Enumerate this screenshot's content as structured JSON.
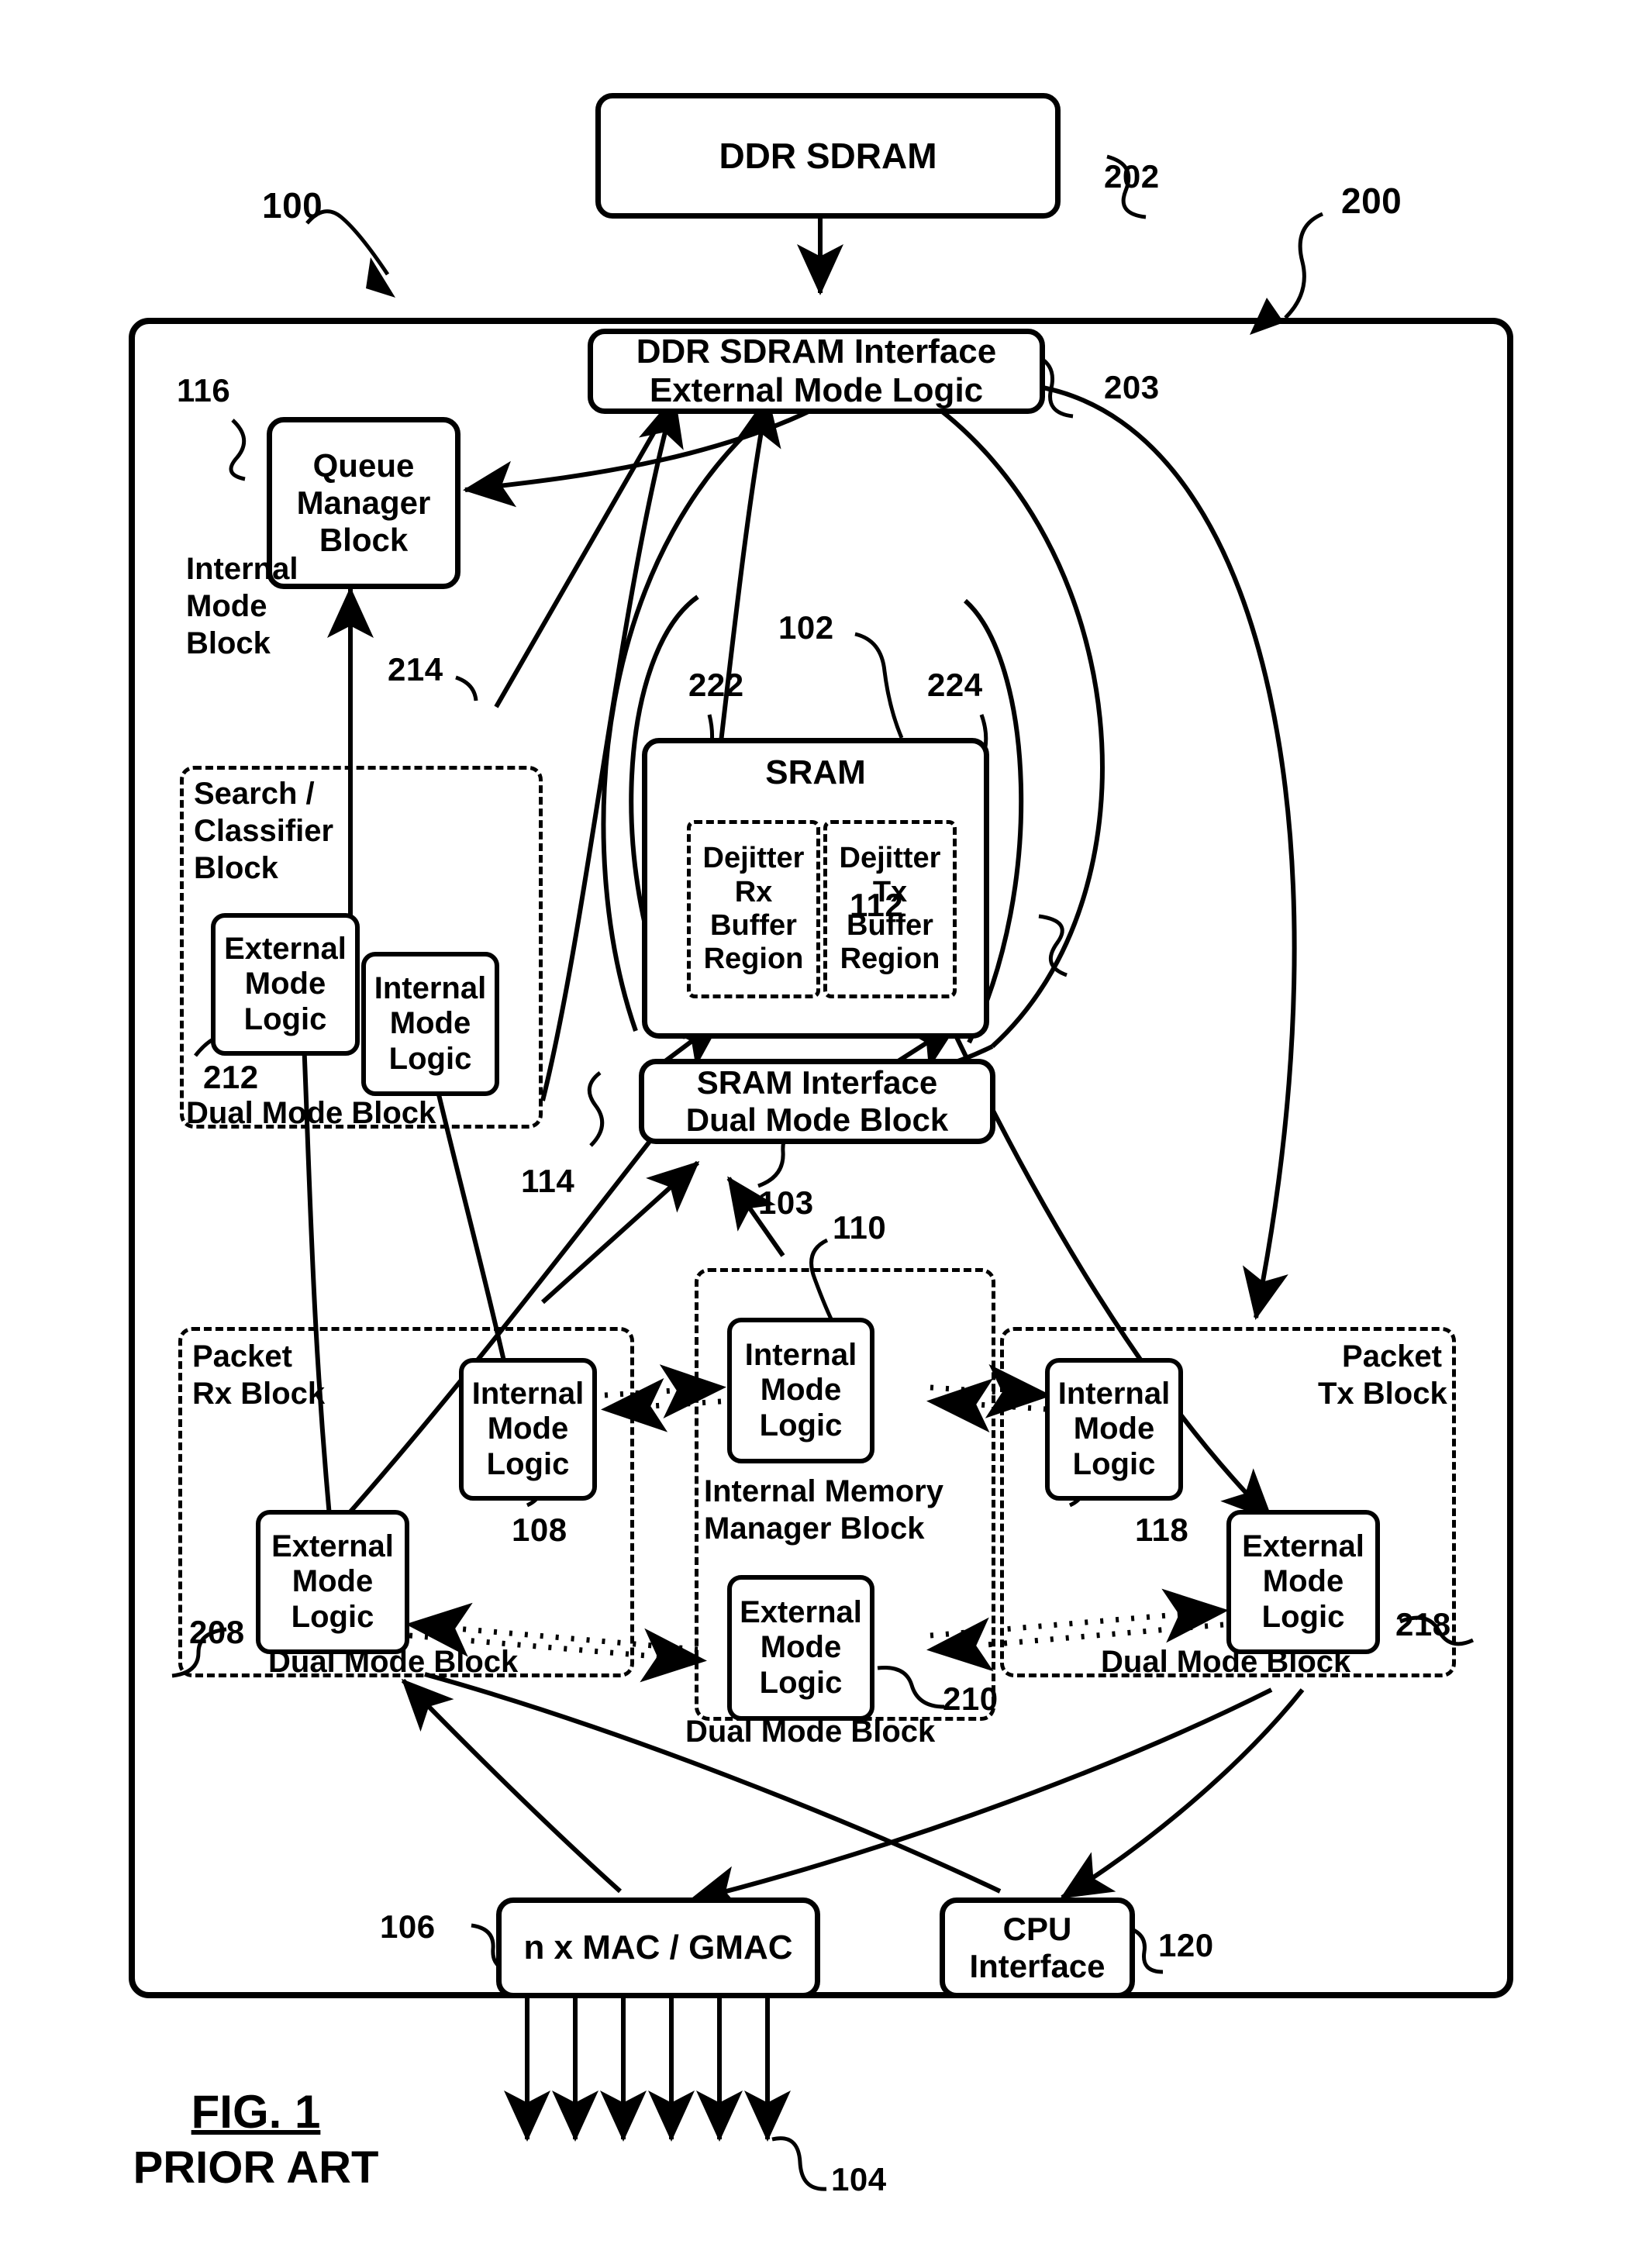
{
  "figure": {
    "caption": "FIG. 1",
    "subcaption": "PRIOR ART"
  },
  "reference_numerals": {
    "n100": "100",
    "n200": "200",
    "n202": "202",
    "n203": "203",
    "n116": "116",
    "n214": "214",
    "n102": "102",
    "n222": "222",
    "n224": "224",
    "n112": "112",
    "n212": "212",
    "n114": "114",
    "n103": "103",
    "n110": "110",
    "n108": "108",
    "n118": "118",
    "n208": "208",
    "n218": "218",
    "n210": "210",
    "n106": "106",
    "n120": "120",
    "n104": "104"
  },
  "blocks": {
    "ddr_sdram": "DDR SDRAM",
    "ddr_interface": "DDR SDRAM Interface\nExternal Mode Logic",
    "queue_manager": "Queue\nManager\nBlock",
    "internal_mode_block_label": "Internal\nMode\nBlock",
    "search_classifier_label": "Search /\nClassifier\nBlock",
    "search_external": "External\nMode\nLogic",
    "search_internal": "Internal\nMode\nLogic",
    "search_dual_mode_label": "Dual Mode Block",
    "sram": "SRAM",
    "dejitter_rx": "Dejitter\nRx\nBuffer\nRegion",
    "dejitter_tx": "Dejitter\nTx\nBuffer\nRegion",
    "sram_interface": "SRAM Interface\nDual Mode Block",
    "packet_rx_label": "Packet\nRx Block",
    "packet_rx_internal": "Internal\nMode\nLogic",
    "packet_rx_external": "External\nMode\nLogic",
    "packet_rx_dual_label": "Dual Mode Block",
    "imm_internal": "Internal\nMode\nLogic",
    "imm_label": "Internal Memory\nManager Block",
    "imm_external": "External\nMode\nLogic",
    "imm_dual_label": "Dual Mode Block",
    "packet_tx_label": "Packet\nTx Block",
    "packet_tx_internal": "Internal\nMode\nLogic",
    "packet_tx_external": "External\nMode\nLogic",
    "packet_tx_dual_label": "Dual Mode Block",
    "mac_gmac": "n x MAC / GMAC",
    "cpu_interface": "CPU\nInterface"
  },
  "colors": {
    "line": "#000000",
    "background": "#ffffff"
  }
}
